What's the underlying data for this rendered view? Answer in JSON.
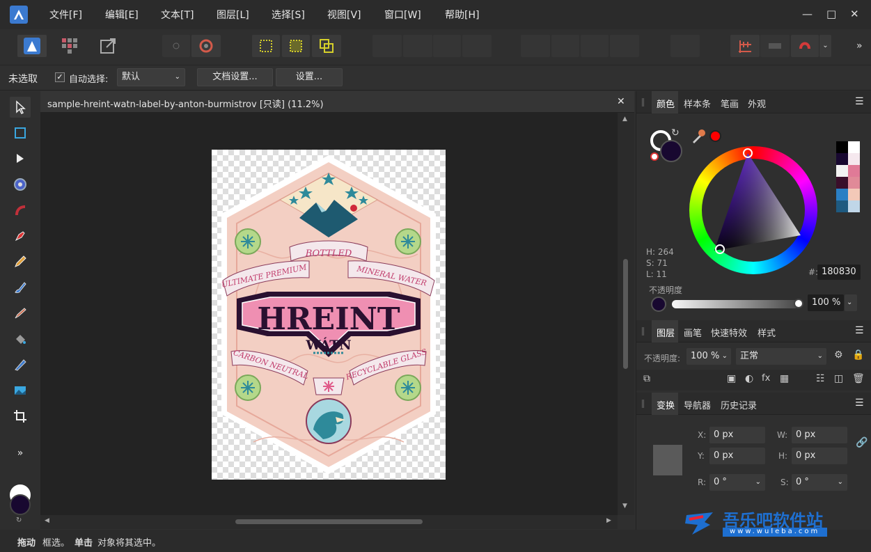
{
  "menubar": {
    "items": [
      "文件[F]",
      "编辑[E]",
      "文本[T]",
      "图层[L]",
      "选择[S]",
      "视图[V]",
      "窗口[W]",
      "帮助[H]"
    ]
  },
  "context": {
    "selection_label": "未选取",
    "auto_select_label": "自动选择:",
    "auto_select_value": "默认",
    "doc_setup_button": "文档设置...",
    "settings_button": "设置..."
  },
  "document": {
    "tab_title": "sample-hreint-watn-label-by-anton-burmistrov [只读] (11.2%)"
  },
  "artwork": {
    "texts": [
      "BOTTLED",
      "ULTIMATE PREMIUM",
      "MINERAL WATER",
      "HREINT",
      "WÁTN",
      "CARBON NEUTRAL",
      "RECYCLABLE GLASS"
    ]
  },
  "color_panel": {
    "tabs": [
      "颜色",
      "样本条",
      "笔画",
      "外观"
    ],
    "h_label": "H: 264",
    "s_label": "S: 71",
    "l_label": "L: 11",
    "hex_prefix": "#:",
    "hex_value": "180830",
    "opacity_label": "不透明度",
    "opacity_value": "100 %",
    "current_color": "#180830",
    "swatches": [
      "#000000",
      "#ffffff",
      "#180830",
      "#f5e8ee",
      "#f2f2f2",
      "#e07a97",
      "#3a0e2a",
      "#e08a98",
      "#2a7fc4",
      "#f3c9b8",
      "#1e5a80",
      "#c0d6e8"
    ]
  },
  "layers_panel": {
    "tabs": [
      "图层",
      "画笔",
      "快速特效",
      "样式"
    ],
    "opacity_label": "不透明度:",
    "opacity_value": "100 %",
    "blend_mode": "正常"
  },
  "transform_panel": {
    "tabs": [
      "变换",
      "导航器",
      "历史记录"
    ],
    "x_label": "X:",
    "x_value": "0 px",
    "y_label": "Y:",
    "y_value": "0 px",
    "w_label": "W:",
    "w_value": "0 px",
    "h_label": "H:",
    "h_value": "0 px",
    "r_label": "R:",
    "r_value": "0 °",
    "s_label": "S:",
    "s_value": "0 °"
  },
  "status": {
    "drag_bold": "拖动",
    "drag_text": "框选。",
    "click_bold": "单击",
    "click_text": "对象将其选中。"
  },
  "watermark": {
    "name": "吾乐吧软件站",
    "url": "www.wuleba.com"
  }
}
